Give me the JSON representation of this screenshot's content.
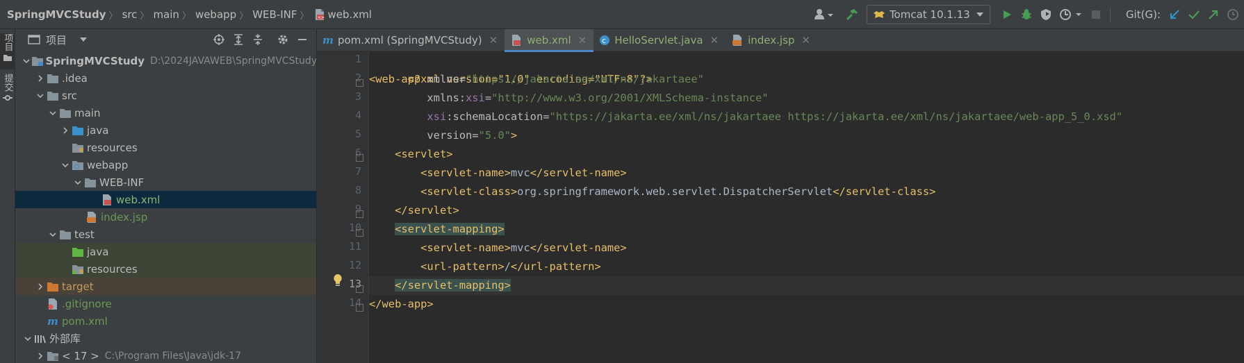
{
  "breadcrumb": {
    "items": [
      "SpringMVCStudy",
      "src",
      "main",
      "webapp",
      "WEB-INF"
    ],
    "file": "web.xml"
  },
  "toolbar": {
    "run_config": "Tomcat 10.1.13",
    "git_label": "Git(G):"
  },
  "left_strip": {
    "project_tab": "项目",
    "commit_tab": "提交"
  },
  "project_panel": {
    "title": "项目",
    "tree": [
      {
        "label": "SpringMVCStudy",
        "path": "D:\\2024JAVAWEB\\SpringMVCStudy",
        "icon": "module-folder-icon",
        "expanded": true
      },
      {
        "label": ".idea",
        "icon": "folder-icon",
        "expanded": false
      },
      {
        "label": "src",
        "icon": "folder-icon",
        "expanded": true
      },
      {
        "label": "main",
        "icon": "folder-icon",
        "expanded": true
      },
      {
        "label": "java",
        "icon": "source-folder-icon",
        "expanded": false
      },
      {
        "label": "resources",
        "icon": "resources-folder-icon"
      },
      {
        "label": "webapp",
        "icon": "web-folder-icon",
        "expanded": true
      },
      {
        "label": "WEB-INF",
        "icon": "folder-icon",
        "expanded": true
      },
      {
        "label": "web.xml",
        "icon": "xml-file-icon"
      },
      {
        "label": "index.jsp",
        "icon": "jsp-file-icon"
      },
      {
        "label": "test",
        "icon": "folder-icon",
        "expanded": true
      },
      {
        "label": "java",
        "icon": "test-source-folder-icon"
      },
      {
        "label": "resources",
        "icon": "test-resources-folder-icon"
      },
      {
        "label": "target",
        "icon": "excluded-folder-icon",
        "expanded": false
      },
      {
        "label": ".gitignore",
        "icon": "gitignore-file-icon"
      },
      {
        "label": "pom.xml",
        "icon": "maven-file-icon"
      },
      {
        "label": "外部库",
        "icon": "library-icon",
        "expanded": true
      },
      {
        "label": "< 17 >",
        "path": "C:\\Program Files\\Java\\jdk-17",
        "icon": "jdk-folder-icon",
        "expanded": false
      }
    ]
  },
  "tabs": [
    {
      "label": "pom.xml (SpringMVCStudy)",
      "icon": "maven-file-icon",
      "active": false
    },
    {
      "label": "web.xml",
      "icon": "xml-file-icon",
      "active": true
    },
    {
      "label": "HelloServlet.java",
      "icon": "java-class-icon",
      "active": false
    },
    {
      "label": "index.jsp",
      "icon": "jsp-file-icon",
      "active": false
    }
  ],
  "editor": {
    "current_line": 13,
    "line_numbers": [
      "1",
      "2",
      "3",
      "4",
      "5",
      "6",
      "7",
      "8",
      "9",
      "10",
      "11",
      "12",
      "13",
      "14"
    ],
    "code": {
      "l1_decl": "<?xml version=\"1.0\" encoding=\"UTF-8\"?>",
      "l2_tag": "<web-app",
      "l2_attr": " xmlns=",
      "l2_val": "\"https://jakarta.ee/xml/ns/jakartaee\"",
      "l3_indent": "         ",
      "l3_attr": "xmlns:",
      "l3_ns": "xsi",
      "l3_eq": "=",
      "l3_val": "\"http://www.w3.org/2001/XMLSchema-instance\"",
      "l4_indent": "         ",
      "l4_ns": "xsi",
      "l4_attr": ":schemaLocation=",
      "l4_val": "\"https://jakarta.ee/xml/ns/jakartaee https://jakarta.ee/xml/ns/jakartaee/web-app_5_0.xsd\"",
      "l5_indent": "         ",
      "l5_attr": "version=",
      "l5_val": "\"5.0\"",
      "l5_close": ">",
      "l6_indent": "    ",
      "l6_tag": "<servlet>",
      "l7_indent": "        ",
      "l7_open": "<servlet-name>",
      "l7_text": "mvc",
      "l7_close": "</servlet-name>",
      "l8_indent": "        ",
      "l8_open": "<servlet-class>",
      "l8_text": "org.springframework.web.servlet.DispatcherServlet",
      "l8_close": "</servlet-class>",
      "l9_indent": "    ",
      "l9_tag": "</servlet>",
      "l10_indent": "    ",
      "l10_tag": "<servlet-mapping>",
      "l11_indent": "        ",
      "l11_open": "<servlet-name>",
      "l11_text": "mvc",
      "l11_close": "</servlet-name>",
      "l12_indent": "        ",
      "l12_open": "<url-pattern>",
      "l12_text": "/",
      "l12_close": "</url-pattern>",
      "l13_indent": "    ",
      "l13_tag": "</servlet-mapping>",
      "l14_tag": "</web-app>"
    }
  },
  "colors": {
    "accent": "#4a88c7",
    "tag": "#e8bf6a",
    "string": "#6a8759",
    "namespace": "#9876aa",
    "run_green": "#499c54",
    "git_blue": "#3592c4"
  }
}
